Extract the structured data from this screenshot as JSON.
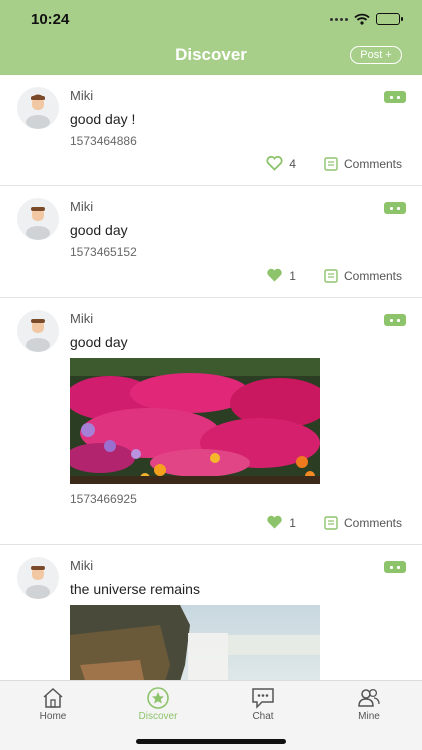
{
  "status_bar": {
    "time": "10:24"
  },
  "header": {
    "title": "Discover",
    "post_button": "Post",
    "post_icon": "plus-icon"
  },
  "posts": [
    {
      "author": "Miki",
      "text": "good day !",
      "timestamp": "1573464886",
      "likes": "4",
      "liked": false,
      "comment_label": "Comments"
    },
    {
      "author": "Miki",
      "text": "good day",
      "timestamp": "1573465152",
      "likes": "1",
      "liked": true,
      "comment_label": "Comments"
    },
    {
      "author": "Miki",
      "text": "good day",
      "timestamp": "1573466925",
      "likes": "1",
      "liked": true,
      "comment_label": "Comments",
      "image": "flower-field-photo"
    },
    {
      "author": "Miki",
      "text": "the universe remains",
      "image": "waterfall-photo"
    }
  ],
  "tabbar": {
    "items": [
      {
        "label": "Home",
        "icon": "home-icon",
        "active": false
      },
      {
        "label": "Discover",
        "icon": "discover-star-icon",
        "active": true
      },
      {
        "label": "Chat",
        "icon": "chat-icon",
        "active": false
      },
      {
        "label": "Mine",
        "icon": "people-icon",
        "active": false
      }
    ]
  },
  "colors": {
    "accent": "#a7cf8a",
    "active": "#8dc36b"
  }
}
